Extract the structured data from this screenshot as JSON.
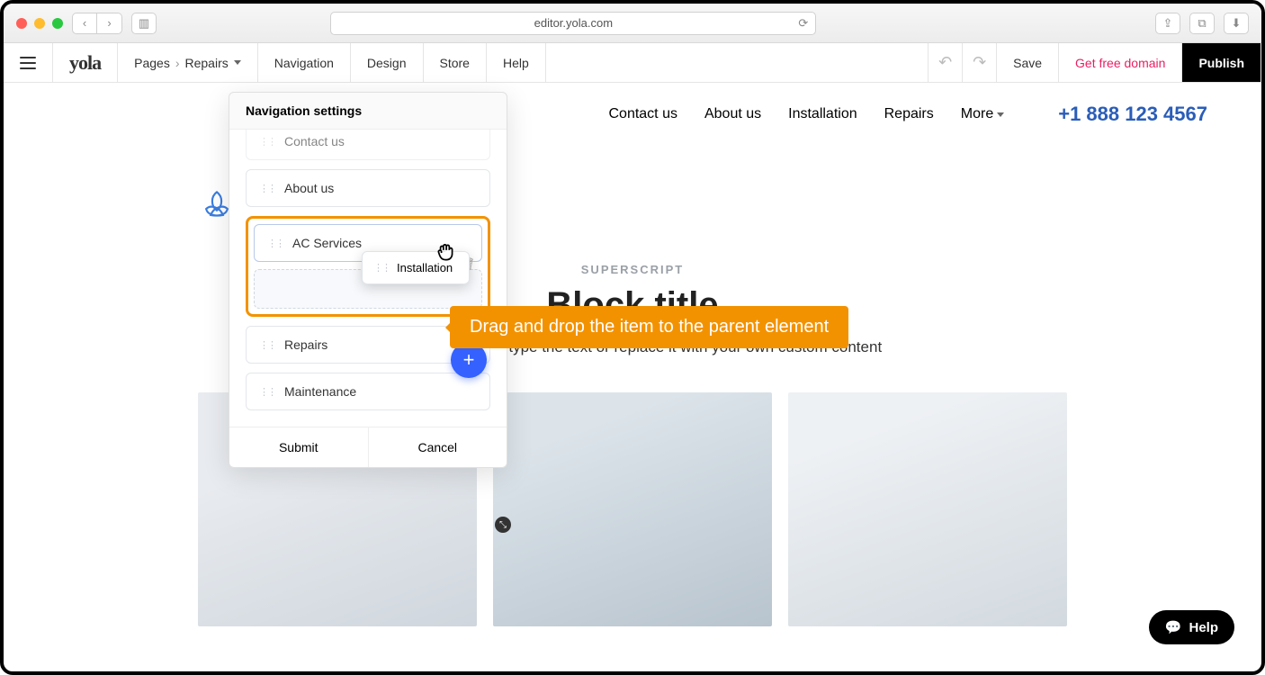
{
  "browser": {
    "url": "editor.yola.com"
  },
  "toolbar": {
    "logo": "yola",
    "pages_label": "Pages",
    "current_page": "Repairs",
    "navigation": "Navigation",
    "design": "Design",
    "store": "Store",
    "help": "Help",
    "save": "Save",
    "free_domain": "Get free domain",
    "publish": "Publish"
  },
  "site": {
    "nav": [
      "Contact us",
      "About us",
      "Installation",
      "Repairs"
    ],
    "more": "More",
    "phone": "+1 888 123 4567",
    "superscript": "SUPERSCRIPT",
    "block_title": "Block title",
    "block_desc": ". To edit, click and type the text or replace it with your own custom content"
  },
  "navpanel": {
    "title": "Navigation settings",
    "items_top": [
      "Contact us",
      "About us"
    ],
    "drop_parent": "AC Services",
    "dragging": "Installation",
    "items_bottom": [
      "Repairs",
      "Maintenance"
    ],
    "submit": "Submit",
    "cancel": "Cancel"
  },
  "tooltip": "Drag and drop the item to the parent element",
  "help": "Help"
}
